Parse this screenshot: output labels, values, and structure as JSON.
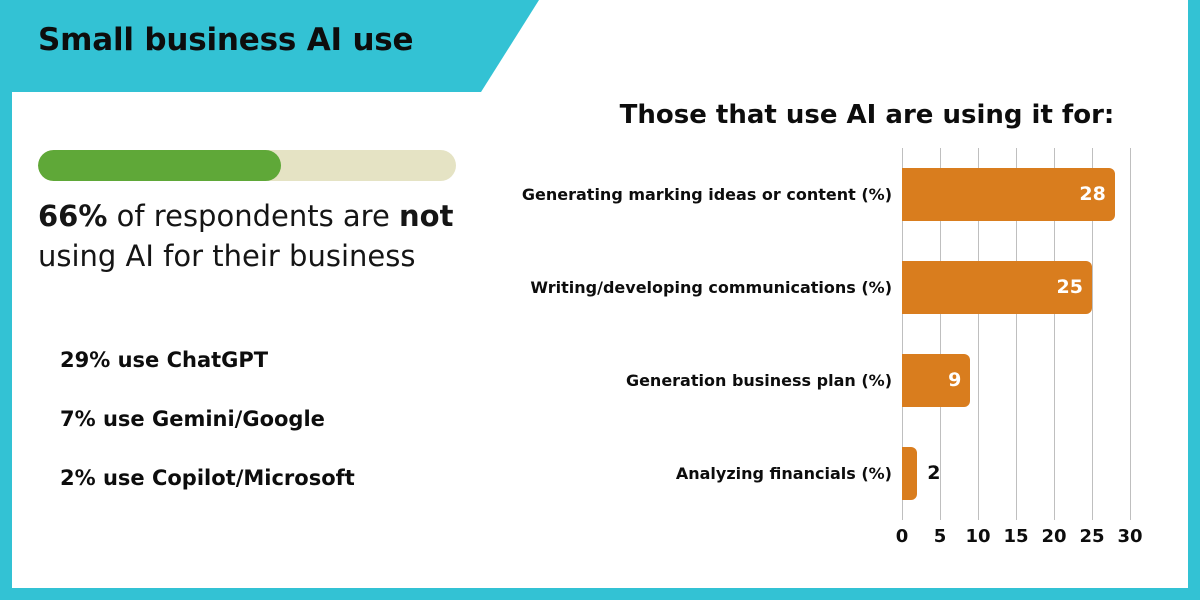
{
  "colors": {
    "teal": "#33C2D4",
    "bar_orange": "#D97D1E",
    "progress_green": "#5FA838",
    "progress_track": "#E5E3C4",
    "text_dark": "#0d0d0d",
    "gridline": "#BFBFBF"
  },
  "banner": {
    "title": "Small business AI use"
  },
  "left_panel": {
    "progress": {
      "percent_label": "66%",
      "percent_value": 66
    },
    "headline": {
      "lead": "66%",
      "middle": " of respondents are ",
      "emphasis": "not",
      "tail": "using AI for their business"
    },
    "stats": [
      {
        "label": "29% use ChatGPT"
      },
      {
        "label": "7% use Gemini/Google"
      },
      {
        "label": "2% use Copilot/Microsoft"
      }
    ]
  },
  "chart_data": {
    "type": "bar",
    "orientation": "horizontal",
    "title": "Those that use AI are using it for:",
    "xlabel": "",
    "ylabel": "",
    "xlim": [
      0,
      30
    ],
    "grid": true,
    "legend": false,
    "xticks": [
      0,
      5,
      10,
      15,
      20,
      25,
      30
    ],
    "xtick_labels": [
      "0",
      "5",
      "10",
      "15",
      "20",
      "25",
      "30"
    ],
    "categories": [
      "Generating marking ideas or content (%)",
      "Writing/developing communications (%)",
      "Generation business plan (%)",
      "Analyzing financials (%)"
    ],
    "values": [
      28,
      25,
      9,
      2
    ],
    "value_labels": [
      "28",
      "25",
      "9",
      "2"
    ],
    "label_placement": [
      "inside",
      "inside",
      "inside",
      "outside"
    ],
    "bar_color": "#D97D1E"
  }
}
